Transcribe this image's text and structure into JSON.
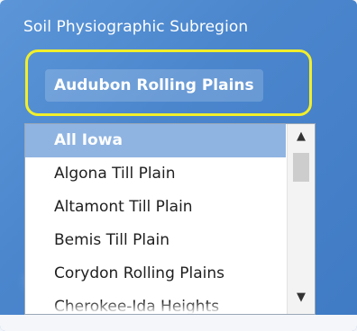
{
  "field": {
    "label": "Soil Physiographic Subregion",
    "selected_value": "Audubon Rolling Plains"
  },
  "dropdown": {
    "items": [
      "All Iowa",
      "Algona Till Plain",
      "Altamont Till Plain",
      "Bemis Till Plain",
      "Corydon Rolling Plains",
      "Cherokee-Ida Heights"
    ],
    "selected_index": 0
  },
  "icons": {
    "scroll_up": "▲",
    "scroll_down": "▼"
  },
  "colors": {
    "background": "#4b86cd",
    "highlight_ring": "#f2ef2a",
    "selected_item": "#8fb4e2"
  }
}
